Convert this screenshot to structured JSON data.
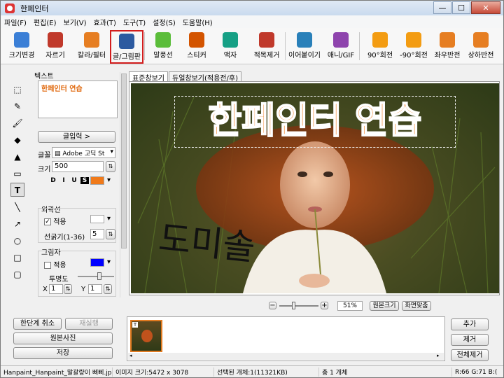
{
  "window": {
    "title": "한페인터",
    "min": "—",
    "max": "☐",
    "close": "✕"
  },
  "menu": [
    "파일(F)",
    "편집(E)",
    "보기(V)",
    "효과(T)",
    "도구(T)",
    "설정(S)",
    "도움말(H)"
  ],
  "toolbar": [
    {
      "label": "크기변경",
      "icon": "resize-icon",
      "color": "#3b7fd6"
    },
    {
      "label": "자르기",
      "icon": "crop-icon",
      "color": "#c0392b"
    },
    {
      "label": "칼라/필터",
      "icon": "color-filter-icon",
      "color": "#e67e22"
    },
    {
      "label": "글/그림판",
      "icon": "text-drawing-icon",
      "color": "#2c5aa0",
      "selected": true
    },
    {
      "label": "말풍선",
      "icon": "speech-bubble-icon",
      "color": "#5bbd3a"
    },
    {
      "label": "스티커",
      "icon": "sticker-icon",
      "color": "#d35400"
    },
    {
      "label": "액자",
      "icon": "frame-icon",
      "color": "#16a085"
    },
    {
      "label": "적목제거",
      "icon": "red-eye-icon",
      "color": "#c0392b"
    },
    {
      "label": "이어붙이기",
      "icon": "merge-icon",
      "color": "#2980b9"
    },
    {
      "label": "애니/GIF",
      "icon": "gif-icon",
      "color": "#8e44ad"
    },
    {
      "label": "90°회전",
      "icon": "rotate-cw-icon",
      "color": "#f39c12"
    },
    {
      "label": "-90°회전",
      "icon": "rotate-ccw-icon",
      "color": "#f39c12"
    },
    {
      "label": "좌우반전",
      "icon": "flip-horizontal-icon",
      "color": "#e67e22"
    },
    {
      "label": "상하반전",
      "icon": "flip-vertical-icon",
      "color": "#e67e22"
    }
  ],
  "left": {
    "section_text": "텍스트",
    "text_value": "한페인터 연습",
    "input_button": "글입력 >",
    "font_label": "글꼴",
    "font_value": "Adobe 고딕 St",
    "size_label": "크기",
    "size_value": "500",
    "style_buttons": [
      "D",
      "I",
      "U",
      "S"
    ],
    "text_color": "#f07a1a",
    "outline_title": "외곽선",
    "outline_apply": "적용",
    "outline_apply_checked": true,
    "outline_width_label": "선굵기(1-36)",
    "outline_width_value": "5",
    "outline_color": "#ffffff",
    "shadow_title": "그림자",
    "shadow_apply": "적용",
    "shadow_apply_checked": false,
    "shadow_color": "#0000ff",
    "opacity_label": "투명도",
    "x_label": "X",
    "x_value": "1",
    "y_label": "Y",
    "y_value": "1",
    "opacity_level": 0.6
  },
  "tools": [
    {
      "name": "select-tool-icon",
      "glyph": "⬚"
    },
    {
      "name": "pen-tool-icon",
      "glyph": "✎"
    },
    {
      "name": "brush-tool-icon",
      "glyph": "🖌"
    },
    {
      "name": "fill-tool-icon",
      "glyph": "◆"
    },
    {
      "name": "spray-tool-icon",
      "glyph": "▲"
    },
    {
      "name": "eraser-tool-icon",
      "glyph": "▭"
    },
    {
      "name": "text-tool-icon",
      "glyph": "T",
      "selected": true
    },
    {
      "name": "line-tool-icon",
      "glyph": "╲"
    },
    {
      "name": "arrow-tool-icon",
      "glyph": "↗"
    },
    {
      "name": "circle-tool-icon",
      "glyph": "○"
    },
    {
      "name": "rectangle-tool-icon",
      "glyph": "□"
    },
    {
      "name": "rounded-rect-tool-icon",
      "glyph": "▢"
    }
  ],
  "tabs": [
    "표준창보기",
    "듀얼창보기(적용전/후)"
  ],
  "canvas": {
    "overlay_text": "한페인터 연습",
    "overlay_text_color": "#f07a1a",
    "handwriting": "도미솔"
  },
  "zoom": {
    "minus": "−",
    "plus": "+",
    "level": "51%",
    "original_size": "원본크기",
    "fit_screen": "화면맞춤",
    "slider_level": 0.35
  },
  "bottom_left": {
    "undo": "한단계 취소",
    "redo": "재실행",
    "original_photo": "원본사진",
    "save": "저장"
  },
  "bottom_right": {
    "add": "추가",
    "remove": "제거",
    "remove_all": "전체제거"
  },
  "status": {
    "file": "Hanpaint_Hanpaint_말괄량이 삐삐.jpg",
    "image_size": "이미지 크기:5472 x 3078",
    "selected": "선택된 개체:1(11321KB)",
    "total": "총 1 개체",
    "rgb": "R:66 G:71 B:("
  }
}
